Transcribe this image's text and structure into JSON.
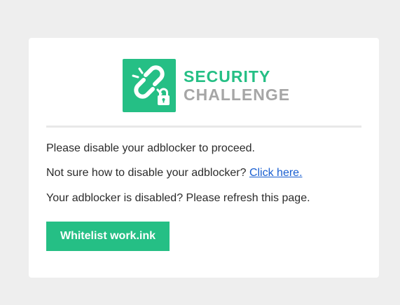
{
  "brand": {
    "title_line1": "SECURITY",
    "title_line2": "CHALLENGE",
    "icon": "chain-link-lock-icon",
    "accent_color": "#25bf85",
    "secondary_color": "#a6a6a6"
  },
  "messages": {
    "line1": "Please disable your adblocker to proceed.",
    "line2_prefix": "Not sure how to disable your adblocker? ",
    "line2_link": "Click here.",
    "line3": "Your adblocker is disabled? Please refresh this page."
  },
  "actions": {
    "whitelist_label": "Whitelist work.ink"
  }
}
